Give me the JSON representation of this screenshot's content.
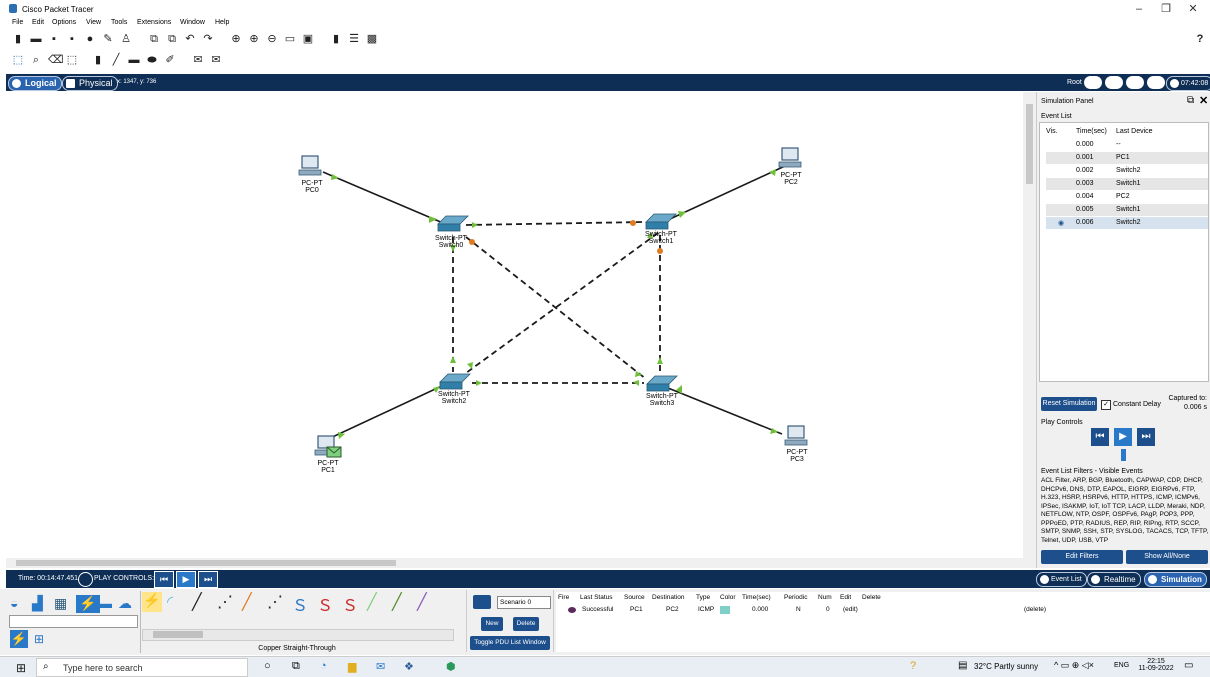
{
  "app": {
    "title": "Cisco Packet Tracer",
    "window_min": "–",
    "window_max": "❐",
    "window_close": "✕",
    "help_icon": "?"
  },
  "menu": [
    "File",
    "Edit",
    "Options",
    "View",
    "Tools",
    "Extensions",
    "Window",
    "Help"
  ],
  "tabs": {
    "logical": "Logical",
    "physical": "Physical",
    "coords": "x: 1347, y: 736"
  },
  "topright": {
    "root": "Root",
    "time": "07:42:08"
  },
  "devices": [
    {
      "type": "PC-PT",
      "name": "PC0"
    },
    {
      "type": "PC-PT",
      "name": "PC2"
    },
    {
      "type": "PC-PT",
      "name": "PC1"
    },
    {
      "type": "PC-PT",
      "name": "PC3"
    },
    {
      "type": "Switch-PT",
      "name": "Switch0"
    },
    {
      "type": "Switch-PT",
      "name": "Switch1"
    },
    {
      "type": "Switch-PT",
      "name": "Switch2"
    },
    {
      "type": "Switch-PT",
      "name": "Switch3"
    }
  ],
  "sim_panel": {
    "title": "Simulation Panel",
    "event_list": "Event List",
    "cols": [
      "Vis.",
      "Time(sec)",
      "Last Device"
    ],
    "events": [
      {
        "time": "0.000",
        "device": "--"
      },
      {
        "time": "0.001",
        "device": "PC1"
      },
      {
        "time": "0.002",
        "device": "Switch2"
      },
      {
        "time": "0.003",
        "device": "Switch1"
      },
      {
        "time": "0.004",
        "device": "PC2"
      },
      {
        "time": "0.005",
        "device": "Switch1"
      },
      {
        "time": "0.006",
        "device": "Switch2"
      }
    ],
    "reset": "Reset Simulation",
    "constant_delay": "Constant Delay",
    "captured_label": "Captured to:",
    "captured_value": "0.006 s",
    "play_controls": "Play Controls",
    "filters_title": "Event List Filters - Visible Events",
    "filters_text": "ACL Filter, ARP, BGP, Bluetooth, CAPWAP, CDP, DHCP, DHCPv6, DNS, DTP, EAPOL, EIGRP, EIGRPv6, FTP, H.323, HSRP, HSRPv6, HTTP, HTTPS, ICMP, ICMPv6, IPSec, ISAKMP, IoT, IoT TCP, LACP, LLDP, Meraki, NDP, NETFLOW, NTP, OSPF, OSPFv6, PAgP, POP3, PPP, PPPoED, PTP, RADIUS, REP, RIP, RIPng, RTP, SCCP, SMTP, SNMP, SSH, STP, SYSLOG, TACACS, TCP, TFTP, Telnet, UDP, USB, VTP",
    "edit_filters": "Edit Filters",
    "show_all": "Show All/None"
  },
  "lowbar": {
    "time": "Time: 00:14:47.451",
    "play_controls": "PLAY CONTROLS:",
    "event_list": "Event List",
    "realtime": "Realtime",
    "simulation": "Simulation"
  },
  "bottom": {
    "cable_label": "Copper Straight-Through",
    "scenario": "Scenario 0",
    "new": "New",
    "delete": "Delete",
    "toggle": "Toggle PDU List Window",
    "pdu_cols": [
      "Fire",
      "Last Status",
      "Source",
      "Destination",
      "Type",
      "Color",
      "Time(sec)",
      "Periodic",
      "Num",
      "Edit",
      "Delete"
    ],
    "pdu_row": {
      "status": "Successful",
      "source": "PC1",
      "dest": "PC2",
      "type": "ICMP",
      "time": "0.000",
      "periodic": "N",
      "num": "0",
      "edit": "(edit)",
      "delete": "(delete)"
    }
  },
  "taskbar": {
    "search": "Type here to search",
    "weather": "32°C  Partly sunny",
    "lang": "ENG",
    "clock": "22:15",
    "date": "11-09-2022"
  },
  "colors": {
    "navy": "#0f2e56",
    "green": "#6fbf3a",
    "orange": "#e07b22",
    "cable": "#1a1a1a"
  }
}
